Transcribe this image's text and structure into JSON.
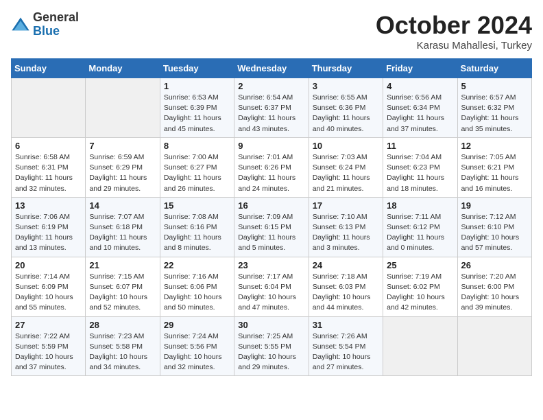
{
  "logo": {
    "general": "General",
    "blue": "Blue"
  },
  "header": {
    "month": "October 2024",
    "location": "Karasu Mahallesi, Turkey"
  },
  "weekdays": [
    "Sunday",
    "Monday",
    "Tuesday",
    "Wednesday",
    "Thursday",
    "Friday",
    "Saturday"
  ],
  "weeks": [
    [
      {
        "num": "",
        "info": ""
      },
      {
        "num": "",
        "info": ""
      },
      {
        "num": "1",
        "info": "Sunrise: 6:53 AM\nSunset: 6:39 PM\nDaylight: 11 hours and 45 minutes."
      },
      {
        "num": "2",
        "info": "Sunrise: 6:54 AM\nSunset: 6:37 PM\nDaylight: 11 hours and 43 minutes."
      },
      {
        "num": "3",
        "info": "Sunrise: 6:55 AM\nSunset: 6:36 PM\nDaylight: 11 hours and 40 minutes."
      },
      {
        "num": "4",
        "info": "Sunrise: 6:56 AM\nSunset: 6:34 PM\nDaylight: 11 hours and 37 minutes."
      },
      {
        "num": "5",
        "info": "Sunrise: 6:57 AM\nSunset: 6:32 PM\nDaylight: 11 hours and 35 minutes."
      }
    ],
    [
      {
        "num": "6",
        "info": "Sunrise: 6:58 AM\nSunset: 6:31 PM\nDaylight: 11 hours and 32 minutes."
      },
      {
        "num": "7",
        "info": "Sunrise: 6:59 AM\nSunset: 6:29 PM\nDaylight: 11 hours and 29 minutes."
      },
      {
        "num": "8",
        "info": "Sunrise: 7:00 AM\nSunset: 6:27 PM\nDaylight: 11 hours and 26 minutes."
      },
      {
        "num": "9",
        "info": "Sunrise: 7:01 AM\nSunset: 6:26 PM\nDaylight: 11 hours and 24 minutes."
      },
      {
        "num": "10",
        "info": "Sunrise: 7:03 AM\nSunset: 6:24 PM\nDaylight: 11 hours and 21 minutes."
      },
      {
        "num": "11",
        "info": "Sunrise: 7:04 AM\nSunset: 6:23 PM\nDaylight: 11 hours and 18 minutes."
      },
      {
        "num": "12",
        "info": "Sunrise: 7:05 AM\nSunset: 6:21 PM\nDaylight: 11 hours and 16 minutes."
      }
    ],
    [
      {
        "num": "13",
        "info": "Sunrise: 7:06 AM\nSunset: 6:19 PM\nDaylight: 11 hours and 13 minutes."
      },
      {
        "num": "14",
        "info": "Sunrise: 7:07 AM\nSunset: 6:18 PM\nDaylight: 11 hours and 10 minutes."
      },
      {
        "num": "15",
        "info": "Sunrise: 7:08 AM\nSunset: 6:16 PM\nDaylight: 11 hours and 8 minutes."
      },
      {
        "num": "16",
        "info": "Sunrise: 7:09 AM\nSunset: 6:15 PM\nDaylight: 11 hours and 5 minutes."
      },
      {
        "num": "17",
        "info": "Sunrise: 7:10 AM\nSunset: 6:13 PM\nDaylight: 11 hours and 3 minutes."
      },
      {
        "num": "18",
        "info": "Sunrise: 7:11 AM\nSunset: 6:12 PM\nDaylight: 11 hours and 0 minutes."
      },
      {
        "num": "19",
        "info": "Sunrise: 7:12 AM\nSunset: 6:10 PM\nDaylight: 10 hours and 57 minutes."
      }
    ],
    [
      {
        "num": "20",
        "info": "Sunrise: 7:14 AM\nSunset: 6:09 PM\nDaylight: 10 hours and 55 minutes."
      },
      {
        "num": "21",
        "info": "Sunrise: 7:15 AM\nSunset: 6:07 PM\nDaylight: 10 hours and 52 minutes."
      },
      {
        "num": "22",
        "info": "Sunrise: 7:16 AM\nSunset: 6:06 PM\nDaylight: 10 hours and 50 minutes."
      },
      {
        "num": "23",
        "info": "Sunrise: 7:17 AM\nSunset: 6:04 PM\nDaylight: 10 hours and 47 minutes."
      },
      {
        "num": "24",
        "info": "Sunrise: 7:18 AM\nSunset: 6:03 PM\nDaylight: 10 hours and 44 minutes."
      },
      {
        "num": "25",
        "info": "Sunrise: 7:19 AM\nSunset: 6:02 PM\nDaylight: 10 hours and 42 minutes."
      },
      {
        "num": "26",
        "info": "Sunrise: 7:20 AM\nSunset: 6:00 PM\nDaylight: 10 hours and 39 minutes."
      }
    ],
    [
      {
        "num": "27",
        "info": "Sunrise: 7:22 AM\nSunset: 5:59 PM\nDaylight: 10 hours and 37 minutes."
      },
      {
        "num": "28",
        "info": "Sunrise: 7:23 AM\nSunset: 5:58 PM\nDaylight: 10 hours and 34 minutes."
      },
      {
        "num": "29",
        "info": "Sunrise: 7:24 AM\nSunset: 5:56 PM\nDaylight: 10 hours and 32 minutes."
      },
      {
        "num": "30",
        "info": "Sunrise: 7:25 AM\nSunset: 5:55 PM\nDaylight: 10 hours and 29 minutes."
      },
      {
        "num": "31",
        "info": "Sunrise: 7:26 AM\nSunset: 5:54 PM\nDaylight: 10 hours and 27 minutes."
      },
      {
        "num": "",
        "info": ""
      },
      {
        "num": "",
        "info": ""
      }
    ]
  ]
}
